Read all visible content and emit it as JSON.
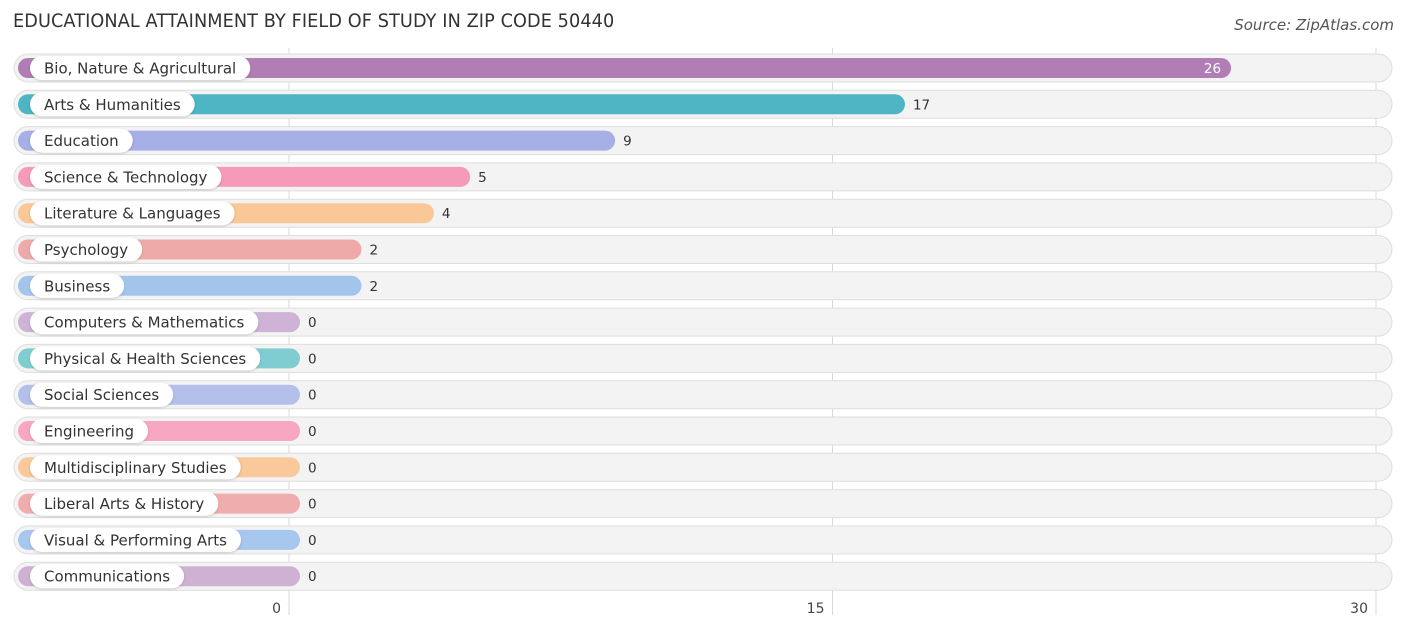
{
  "chart_data": {
    "type": "bar",
    "orientation": "horizontal",
    "title": "EDUCATIONAL ATTAINMENT BY FIELD OF STUDY IN ZIP CODE 50440",
    "source": "Source: ZipAtlas.com",
    "xlabel": "",
    "ylabel": "",
    "xlim": [
      0,
      30
    ],
    "xticks": [
      0,
      15,
      30
    ],
    "xtick_labels": [
      "0",
      "15",
      "30"
    ],
    "grid": true,
    "legend": "none",
    "categories": [
      "Bio, Nature & Agricultural",
      "Arts & Humanities",
      "Education",
      "Science & Technology",
      "Literature & Languages",
      "Psychology",
      "Business",
      "Computers & Mathematics",
      "Physical & Health Sciences",
      "Social Sciences",
      "Engineering",
      "Multidisciplinary Studies",
      "Liberal Arts & History",
      "Visual & Performing Arts",
      "Communications"
    ],
    "values": [
      26,
      17,
      9,
      5,
      4,
      2,
      2,
      0,
      0,
      0,
      0,
      0,
      0,
      0,
      0
    ],
    "value_labels": [
      "26",
      "17",
      "9",
      "5",
      "4",
      "2",
      "2",
      "0",
      "0",
      "0",
      "0",
      "0",
      "0",
      "0",
      "0"
    ],
    "colors": [
      "#b07db5",
      "#4db5c4",
      "#a6afe6",
      "#f59bb8",
      "#f9c896",
      "#eeaaa8",
      "#a3c5ec",
      "#ceb3d6",
      "#7fcdd0",
      "#b5bfec",
      "#f7a7c1",
      "#f9c99c",
      "#f0adad",
      "#a8c7ee",
      "#cfb1d4"
    ]
  }
}
